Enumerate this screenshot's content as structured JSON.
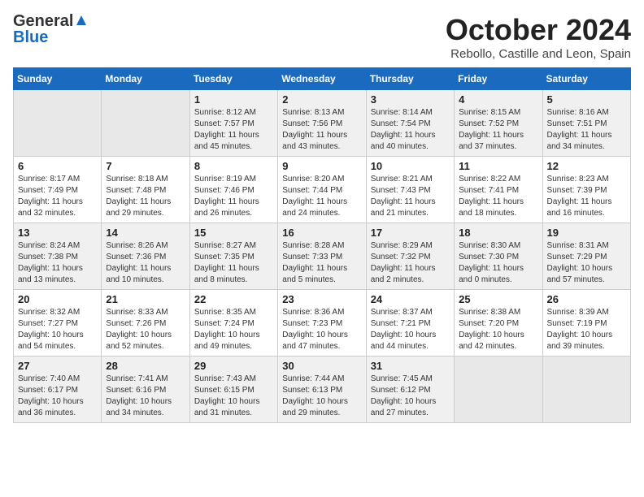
{
  "header": {
    "logo_general": "General",
    "logo_blue": "Blue",
    "title": "October 2024",
    "subtitle": "Rebollo, Castille and Leon, Spain"
  },
  "weekdays": [
    "Sunday",
    "Monday",
    "Tuesday",
    "Wednesday",
    "Thursday",
    "Friday",
    "Saturday"
  ],
  "weeks": [
    [
      {
        "day": "",
        "empty": true
      },
      {
        "day": "",
        "empty": true
      },
      {
        "day": "1",
        "sunrise": "Sunrise: 8:12 AM",
        "sunset": "Sunset: 7:57 PM",
        "daylight": "Daylight: 11 hours and 45 minutes."
      },
      {
        "day": "2",
        "sunrise": "Sunrise: 8:13 AM",
        "sunset": "Sunset: 7:56 PM",
        "daylight": "Daylight: 11 hours and 43 minutes."
      },
      {
        "day": "3",
        "sunrise": "Sunrise: 8:14 AM",
        "sunset": "Sunset: 7:54 PM",
        "daylight": "Daylight: 11 hours and 40 minutes."
      },
      {
        "day": "4",
        "sunrise": "Sunrise: 8:15 AM",
        "sunset": "Sunset: 7:52 PM",
        "daylight": "Daylight: 11 hours and 37 minutes."
      },
      {
        "day": "5",
        "sunrise": "Sunrise: 8:16 AM",
        "sunset": "Sunset: 7:51 PM",
        "daylight": "Daylight: 11 hours and 34 minutes."
      }
    ],
    [
      {
        "day": "6",
        "sunrise": "Sunrise: 8:17 AM",
        "sunset": "Sunset: 7:49 PM",
        "daylight": "Daylight: 11 hours and 32 minutes."
      },
      {
        "day": "7",
        "sunrise": "Sunrise: 8:18 AM",
        "sunset": "Sunset: 7:48 PM",
        "daylight": "Daylight: 11 hours and 29 minutes."
      },
      {
        "day": "8",
        "sunrise": "Sunrise: 8:19 AM",
        "sunset": "Sunset: 7:46 PM",
        "daylight": "Daylight: 11 hours and 26 minutes."
      },
      {
        "day": "9",
        "sunrise": "Sunrise: 8:20 AM",
        "sunset": "Sunset: 7:44 PM",
        "daylight": "Daylight: 11 hours and 24 minutes."
      },
      {
        "day": "10",
        "sunrise": "Sunrise: 8:21 AM",
        "sunset": "Sunset: 7:43 PM",
        "daylight": "Daylight: 11 hours and 21 minutes."
      },
      {
        "day": "11",
        "sunrise": "Sunrise: 8:22 AM",
        "sunset": "Sunset: 7:41 PM",
        "daylight": "Daylight: 11 hours and 18 minutes."
      },
      {
        "day": "12",
        "sunrise": "Sunrise: 8:23 AM",
        "sunset": "Sunset: 7:39 PM",
        "daylight": "Daylight: 11 hours and 16 minutes."
      }
    ],
    [
      {
        "day": "13",
        "sunrise": "Sunrise: 8:24 AM",
        "sunset": "Sunset: 7:38 PM",
        "daylight": "Daylight: 11 hours and 13 minutes."
      },
      {
        "day": "14",
        "sunrise": "Sunrise: 8:26 AM",
        "sunset": "Sunset: 7:36 PM",
        "daylight": "Daylight: 11 hours and 10 minutes."
      },
      {
        "day": "15",
        "sunrise": "Sunrise: 8:27 AM",
        "sunset": "Sunset: 7:35 PM",
        "daylight": "Daylight: 11 hours and 8 minutes."
      },
      {
        "day": "16",
        "sunrise": "Sunrise: 8:28 AM",
        "sunset": "Sunset: 7:33 PM",
        "daylight": "Daylight: 11 hours and 5 minutes."
      },
      {
        "day": "17",
        "sunrise": "Sunrise: 8:29 AM",
        "sunset": "Sunset: 7:32 PM",
        "daylight": "Daylight: 11 hours and 2 minutes."
      },
      {
        "day": "18",
        "sunrise": "Sunrise: 8:30 AM",
        "sunset": "Sunset: 7:30 PM",
        "daylight": "Daylight: 11 hours and 0 minutes."
      },
      {
        "day": "19",
        "sunrise": "Sunrise: 8:31 AM",
        "sunset": "Sunset: 7:29 PM",
        "daylight": "Daylight: 10 hours and 57 minutes."
      }
    ],
    [
      {
        "day": "20",
        "sunrise": "Sunrise: 8:32 AM",
        "sunset": "Sunset: 7:27 PM",
        "daylight": "Daylight: 10 hours and 54 minutes."
      },
      {
        "day": "21",
        "sunrise": "Sunrise: 8:33 AM",
        "sunset": "Sunset: 7:26 PM",
        "daylight": "Daylight: 10 hours and 52 minutes."
      },
      {
        "day": "22",
        "sunrise": "Sunrise: 8:35 AM",
        "sunset": "Sunset: 7:24 PM",
        "daylight": "Daylight: 10 hours and 49 minutes."
      },
      {
        "day": "23",
        "sunrise": "Sunrise: 8:36 AM",
        "sunset": "Sunset: 7:23 PM",
        "daylight": "Daylight: 10 hours and 47 minutes."
      },
      {
        "day": "24",
        "sunrise": "Sunrise: 8:37 AM",
        "sunset": "Sunset: 7:21 PM",
        "daylight": "Daylight: 10 hours and 44 minutes."
      },
      {
        "day": "25",
        "sunrise": "Sunrise: 8:38 AM",
        "sunset": "Sunset: 7:20 PM",
        "daylight": "Daylight: 10 hours and 42 minutes."
      },
      {
        "day": "26",
        "sunrise": "Sunrise: 8:39 AM",
        "sunset": "Sunset: 7:19 PM",
        "daylight": "Daylight: 10 hours and 39 minutes."
      }
    ],
    [
      {
        "day": "27",
        "sunrise": "Sunrise: 7:40 AM",
        "sunset": "Sunset: 6:17 PM",
        "daylight": "Daylight: 10 hours and 36 minutes."
      },
      {
        "day": "28",
        "sunrise": "Sunrise: 7:41 AM",
        "sunset": "Sunset: 6:16 PM",
        "daylight": "Daylight: 10 hours and 34 minutes."
      },
      {
        "day": "29",
        "sunrise": "Sunrise: 7:43 AM",
        "sunset": "Sunset: 6:15 PM",
        "daylight": "Daylight: 10 hours and 31 minutes."
      },
      {
        "day": "30",
        "sunrise": "Sunrise: 7:44 AM",
        "sunset": "Sunset: 6:13 PM",
        "daylight": "Daylight: 10 hours and 29 minutes."
      },
      {
        "day": "31",
        "sunrise": "Sunrise: 7:45 AM",
        "sunset": "Sunset: 6:12 PM",
        "daylight": "Daylight: 10 hours and 27 minutes."
      },
      {
        "day": "",
        "empty": true
      },
      {
        "day": "",
        "empty": true
      }
    ]
  ]
}
